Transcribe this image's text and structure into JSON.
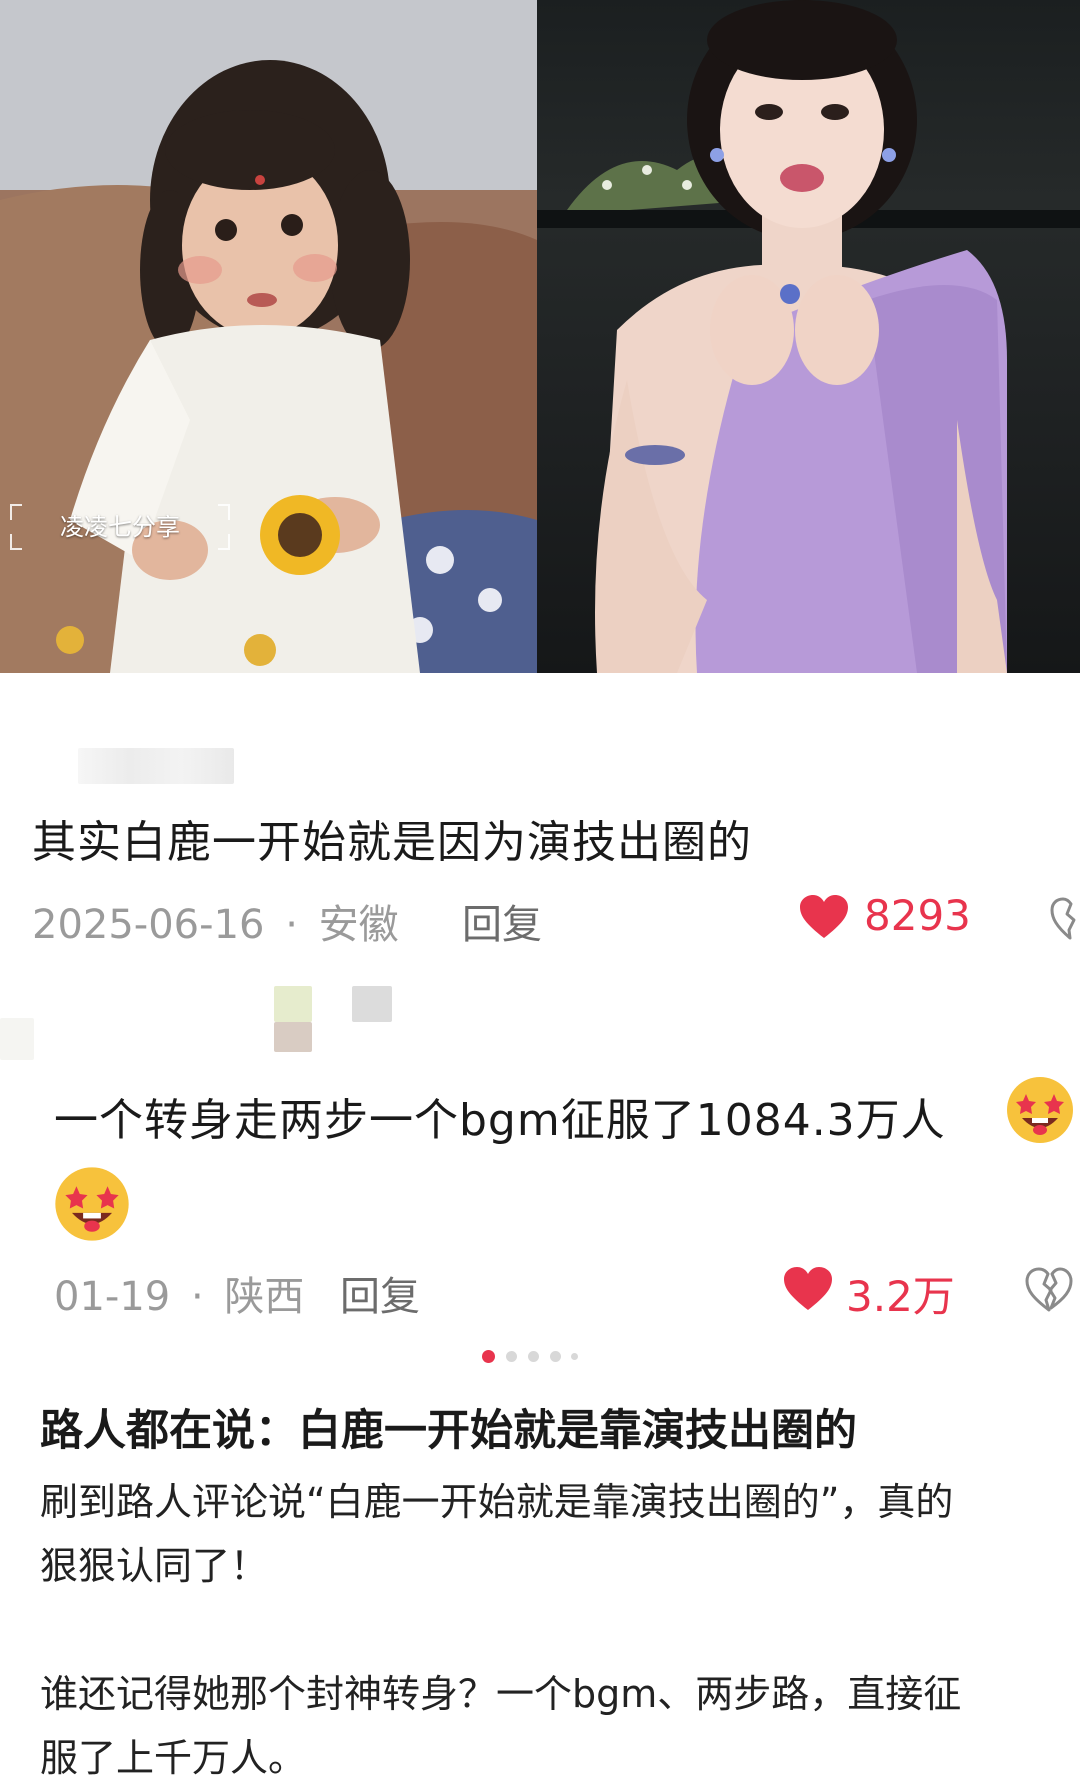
{
  "photos": {
    "left": {
      "watermark": "凌凌七分享"
    }
  },
  "comment1": {
    "text": "其实白鹿一开始就是因为演技出圈的",
    "date": "2025-06-16",
    "sep": "·",
    "location": "安徽",
    "reply_label": "回复",
    "likes": "8293"
  },
  "comment2": {
    "text": "一个转身走两步一个bgm征服了1084.3万人",
    "date": "01-19",
    "sep": "·",
    "location": "陕西",
    "reply_label": "回复",
    "likes": "3.2万",
    "emoji": "star-struck-face-emoji"
  },
  "carousel": {
    "total_dots": 5,
    "active_index": 0
  },
  "article": {
    "title": "路人都在说：白鹿一开始就是靠演技出圈的",
    "paragraph1_line1": "刷到路人评论说“白鹿一开始就是靠演技出圈的”，真的",
    "paragraph1_line2": "狠狠认同了！",
    "paragraph2_line1": "谁还记得她那个封神转身？一个bgm、两步路，直接征",
    "paragraph2_line2": "服了上千万人。"
  },
  "colors": {
    "like_red": "#e8344d",
    "meta_gray": "#9a9a9a",
    "dot_active": "#e8344d",
    "dot_inactive": "#d8d8d8",
    "dress_lilac": "#b79ad8"
  }
}
